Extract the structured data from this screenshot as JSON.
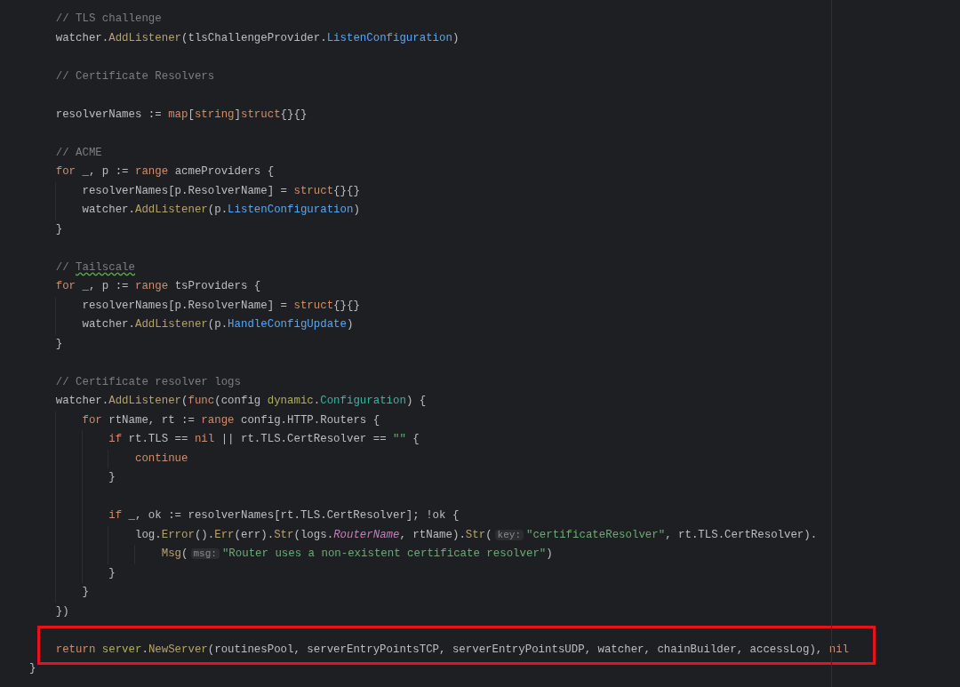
{
  "editor": {
    "lines": [
      {
        "kind": "block",
        "children": [
          {
            "kind": "code",
            "highlighted": false,
            "tokens": [
              {
                "kind": "comment",
                "text": "// TLS challenge"
              }
            ]
          },
          {
            "kind": "code",
            "highlighted": false,
            "tokens": [
              {
                "kind": "plain",
                "text": "watcher."
              },
              {
                "kind": "function",
                "text": "AddListener"
              },
              {
                "kind": "plain",
                "text": "(tlsChallengeProvider."
              },
              {
                "kind": "method_ref",
                "text": "ListenConfiguration"
              },
              {
                "kind": "plain",
                "text": ")"
              }
            ]
          },
          {
            "kind": "blank"
          },
          {
            "kind": "code",
            "highlighted": false,
            "tokens": [
              {
                "kind": "comment",
                "text": "// Certificate Resolvers"
              }
            ]
          },
          {
            "kind": "blank"
          },
          {
            "kind": "code",
            "highlighted": false,
            "tokens": [
              {
                "kind": "plain",
                "text": "resolverNames := "
              },
              {
                "kind": "keyword",
                "text": "map"
              },
              {
                "kind": "plain",
                "text": "["
              },
              {
                "kind": "keyword",
                "text": "string"
              },
              {
                "kind": "plain",
                "text": "]"
              },
              {
                "kind": "keyword",
                "text": "struct"
              },
              {
                "kind": "plain",
                "text": "{}{}"
              }
            ]
          },
          {
            "kind": "blank"
          },
          {
            "kind": "code",
            "highlighted": false,
            "tokens": [
              {
                "kind": "comment",
                "text": "// ACME"
              }
            ]
          },
          {
            "kind": "code",
            "highlighted": false,
            "tokens": [
              {
                "kind": "keyword",
                "text": "for"
              },
              {
                "kind": "plain",
                "text": " _, p := "
              },
              {
                "kind": "keyword",
                "text": "range"
              },
              {
                "kind": "plain",
                "text": " acmeProviders {"
              }
            ],
            "children": [
              {
                "kind": "code",
                "highlighted": false,
                "tokens": [
                  {
                    "kind": "plain",
                    "text": "resolverNames[p.ResolverName] = "
                  },
                  {
                    "kind": "keyword",
                    "text": "struct"
                  },
                  {
                    "kind": "plain",
                    "text": "{}{}"
                  }
                ]
              },
              {
                "kind": "code",
                "highlighted": false,
                "tokens": [
                  {
                    "kind": "plain",
                    "text": "watcher."
                  },
                  {
                    "kind": "function",
                    "text": "AddListener"
                  },
                  {
                    "kind": "plain",
                    "text": "(p."
                  },
                  {
                    "kind": "method_ref",
                    "text": "ListenConfiguration"
                  },
                  {
                    "kind": "plain",
                    "text": ")"
                  }
                ]
              }
            ]
          },
          {
            "kind": "code",
            "highlighted": false,
            "tokens": [
              {
                "kind": "plain",
                "text": "}"
              }
            ]
          },
          {
            "kind": "blank"
          },
          {
            "kind": "code",
            "highlighted": false,
            "tokens": [
              {
                "kind": "comment",
                "text": "//"
              },
              {
                "kind": "typo",
                "text": " Tailscale"
              }
            ]
          },
          {
            "kind": "code",
            "highlighted": false,
            "tokens": [
              {
                "kind": "keyword",
                "text": "for"
              },
              {
                "kind": "plain",
                "text": " _, p := "
              },
              {
                "kind": "keyword",
                "text": "range"
              },
              {
                "kind": "plain",
                "text": " tsProviders {"
              }
            ],
            "children": [
              {
                "kind": "code",
                "highlighted": false,
                "tokens": [
                  {
                    "kind": "plain",
                    "text": "resolverNames[p.ResolverName] = "
                  },
                  {
                    "kind": "keyword",
                    "text": "struct"
                  },
                  {
                    "kind": "plain",
                    "text": "{}{}"
                  }
                ]
              },
              {
                "kind": "code",
                "highlighted": false,
                "tokens": [
                  {
                    "kind": "plain",
                    "text": "watcher."
                  },
                  {
                    "kind": "function",
                    "text": "AddListener"
                  },
                  {
                    "kind": "plain",
                    "text": "(p."
                  },
                  {
                    "kind": "method_ref",
                    "text": "HandleConfigUpdate"
                  },
                  {
                    "kind": "plain",
                    "text": ")"
                  }
                ]
              }
            ]
          },
          {
            "kind": "code",
            "highlighted": false,
            "tokens": [
              {
                "kind": "plain",
                "text": "}"
              }
            ]
          },
          {
            "kind": "blank"
          },
          {
            "kind": "code",
            "highlighted": false,
            "tokens": [
              {
                "kind": "comment",
                "text": "// Certificate resolver logs"
              }
            ]
          },
          {
            "kind": "code",
            "highlighted": false,
            "tokens": [
              {
                "kind": "plain",
                "text": "watcher."
              },
              {
                "kind": "function",
                "text": "AddListener"
              },
              {
                "kind": "plain",
                "text": "("
              },
              {
                "kind": "keyword",
                "text": "func"
              },
              {
                "kind": "plain",
                "text": "(config "
              },
              {
                "kind": "package",
                "text": "dynamic"
              },
              {
                "kind": "plain",
                "text": "."
              },
              {
                "kind": "type",
                "text": "Configuration"
              },
              {
                "kind": "plain",
                "text": ") {"
              }
            ],
            "children": [
              {
                "kind": "code",
                "highlighted": false,
                "tokens": [
                  {
                    "kind": "keyword",
                    "text": "for"
                  },
                  {
                    "kind": "plain",
                    "text": " rtName, rt := "
                  },
                  {
                    "kind": "keyword",
                    "text": "range"
                  },
                  {
                    "kind": "plain",
                    "text": " config.HTTP.Routers {"
                  }
                ],
                "children": [
                  {
                    "kind": "code",
                    "highlighted": false,
                    "tokens": [
                      {
                        "kind": "keyword",
                        "text": "if"
                      },
                      {
                        "kind": "plain",
                        "text": " rt.TLS == "
                      },
                      {
                        "kind": "keyword",
                        "text": "nil"
                      },
                      {
                        "kind": "plain",
                        "text": " || rt.TLS.CertResolver == "
                      },
                      {
                        "kind": "string",
                        "text": "\"\""
                      },
                      {
                        "kind": "plain",
                        "text": " {"
                      }
                    ],
                    "children": [
                      {
                        "kind": "code",
                        "highlighted": false,
                        "tokens": [
                          {
                            "kind": "keyword",
                            "text": "continue"
                          }
                        ]
                      }
                    ]
                  },
                  {
                    "kind": "code",
                    "highlighted": false,
                    "tokens": [
                      {
                        "kind": "plain",
                        "text": "}"
                      }
                    ]
                  },
                  {
                    "kind": "blank"
                  },
                  {
                    "kind": "code",
                    "highlighted": false,
                    "tokens": [
                      {
                        "kind": "keyword",
                        "text": "if"
                      },
                      {
                        "kind": "plain",
                        "text": " _, ok := resolverNames[rt.TLS.CertResolver]; !ok {"
                      }
                    ],
                    "children": [
                      {
                        "kind": "code",
                        "highlighted": false,
                        "tokens": [
                          {
                            "kind": "plain",
                            "text": "log."
                          },
                          {
                            "kind": "function",
                            "text": "Error"
                          },
                          {
                            "kind": "plain",
                            "text": "()."
                          },
                          {
                            "kind": "function",
                            "text": "Err"
                          },
                          {
                            "kind": "plain",
                            "text": "(err)."
                          },
                          {
                            "kind": "function",
                            "text": "Str"
                          },
                          {
                            "kind": "plain",
                            "text": "(logs."
                          },
                          {
                            "kind": "constant",
                            "text": "RouterName"
                          },
                          {
                            "kind": "plain",
                            "text": ", rtName)."
                          },
                          {
                            "kind": "function",
                            "text": "Str"
                          },
                          {
                            "kind": "plain",
                            "text": "("
                          },
                          {
                            "kind": "hint",
                            "text": "key:"
                          },
                          {
                            "kind": "string",
                            "text": "\"certificateResolver\""
                          },
                          {
                            "kind": "plain",
                            "text": ", rt.TLS.CertResolver)."
                          }
                        ],
                        "children": [
                          {
                            "kind": "code",
                            "highlighted": false,
                            "tokens": [
                              {
                                "kind": "function",
                                "text": "Msg"
                              },
                              {
                                "kind": "plain",
                                "text": "("
                              },
                              {
                                "kind": "hint",
                                "text": "msg:"
                              },
                              {
                                "kind": "string",
                                "text": "\"Router uses a non-existent certificate resolver\""
                              },
                              {
                                "kind": "plain",
                                "text": ")"
                              }
                            ]
                          }
                        ]
                      }
                    ]
                  },
                  {
                    "kind": "code",
                    "highlighted": false,
                    "tokens": [
                      {
                        "kind": "plain",
                        "text": "}"
                      }
                    ]
                  }
                ]
              },
              {
                "kind": "code",
                "highlighted": false,
                "tokens": [
                  {
                    "kind": "plain",
                    "text": "}"
                  }
                ]
              }
            ]
          },
          {
            "kind": "code",
            "highlighted": false,
            "tokens": [
              {
                "kind": "plain",
                "text": "})"
              }
            ]
          },
          {
            "kind": "blank"
          },
          {
            "kind": "code",
            "highlighted": true,
            "tokens": [
              {
                "kind": "keyword",
                "text": "return"
              },
              {
                "kind": "package",
                "text": " server"
              },
              {
                "kind": "plain",
                "text": "."
              },
              {
                "kind": "function",
                "text": "NewServer"
              },
              {
                "kind": "plain",
                "text": "(routinesPool, serverEntryPointsTCP, serverEntryPointsUDP, watcher, chainBuilder, accessLog), "
              },
              {
                "kind": "keyword",
                "text": "nil"
              }
            ]
          }
        ]
      },
      {
        "kind": "code",
        "highlighted": false,
        "tokens": [
          {
            "kind": "plain",
            "text": "}"
          }
        ]
      }
    ]
  }
}
